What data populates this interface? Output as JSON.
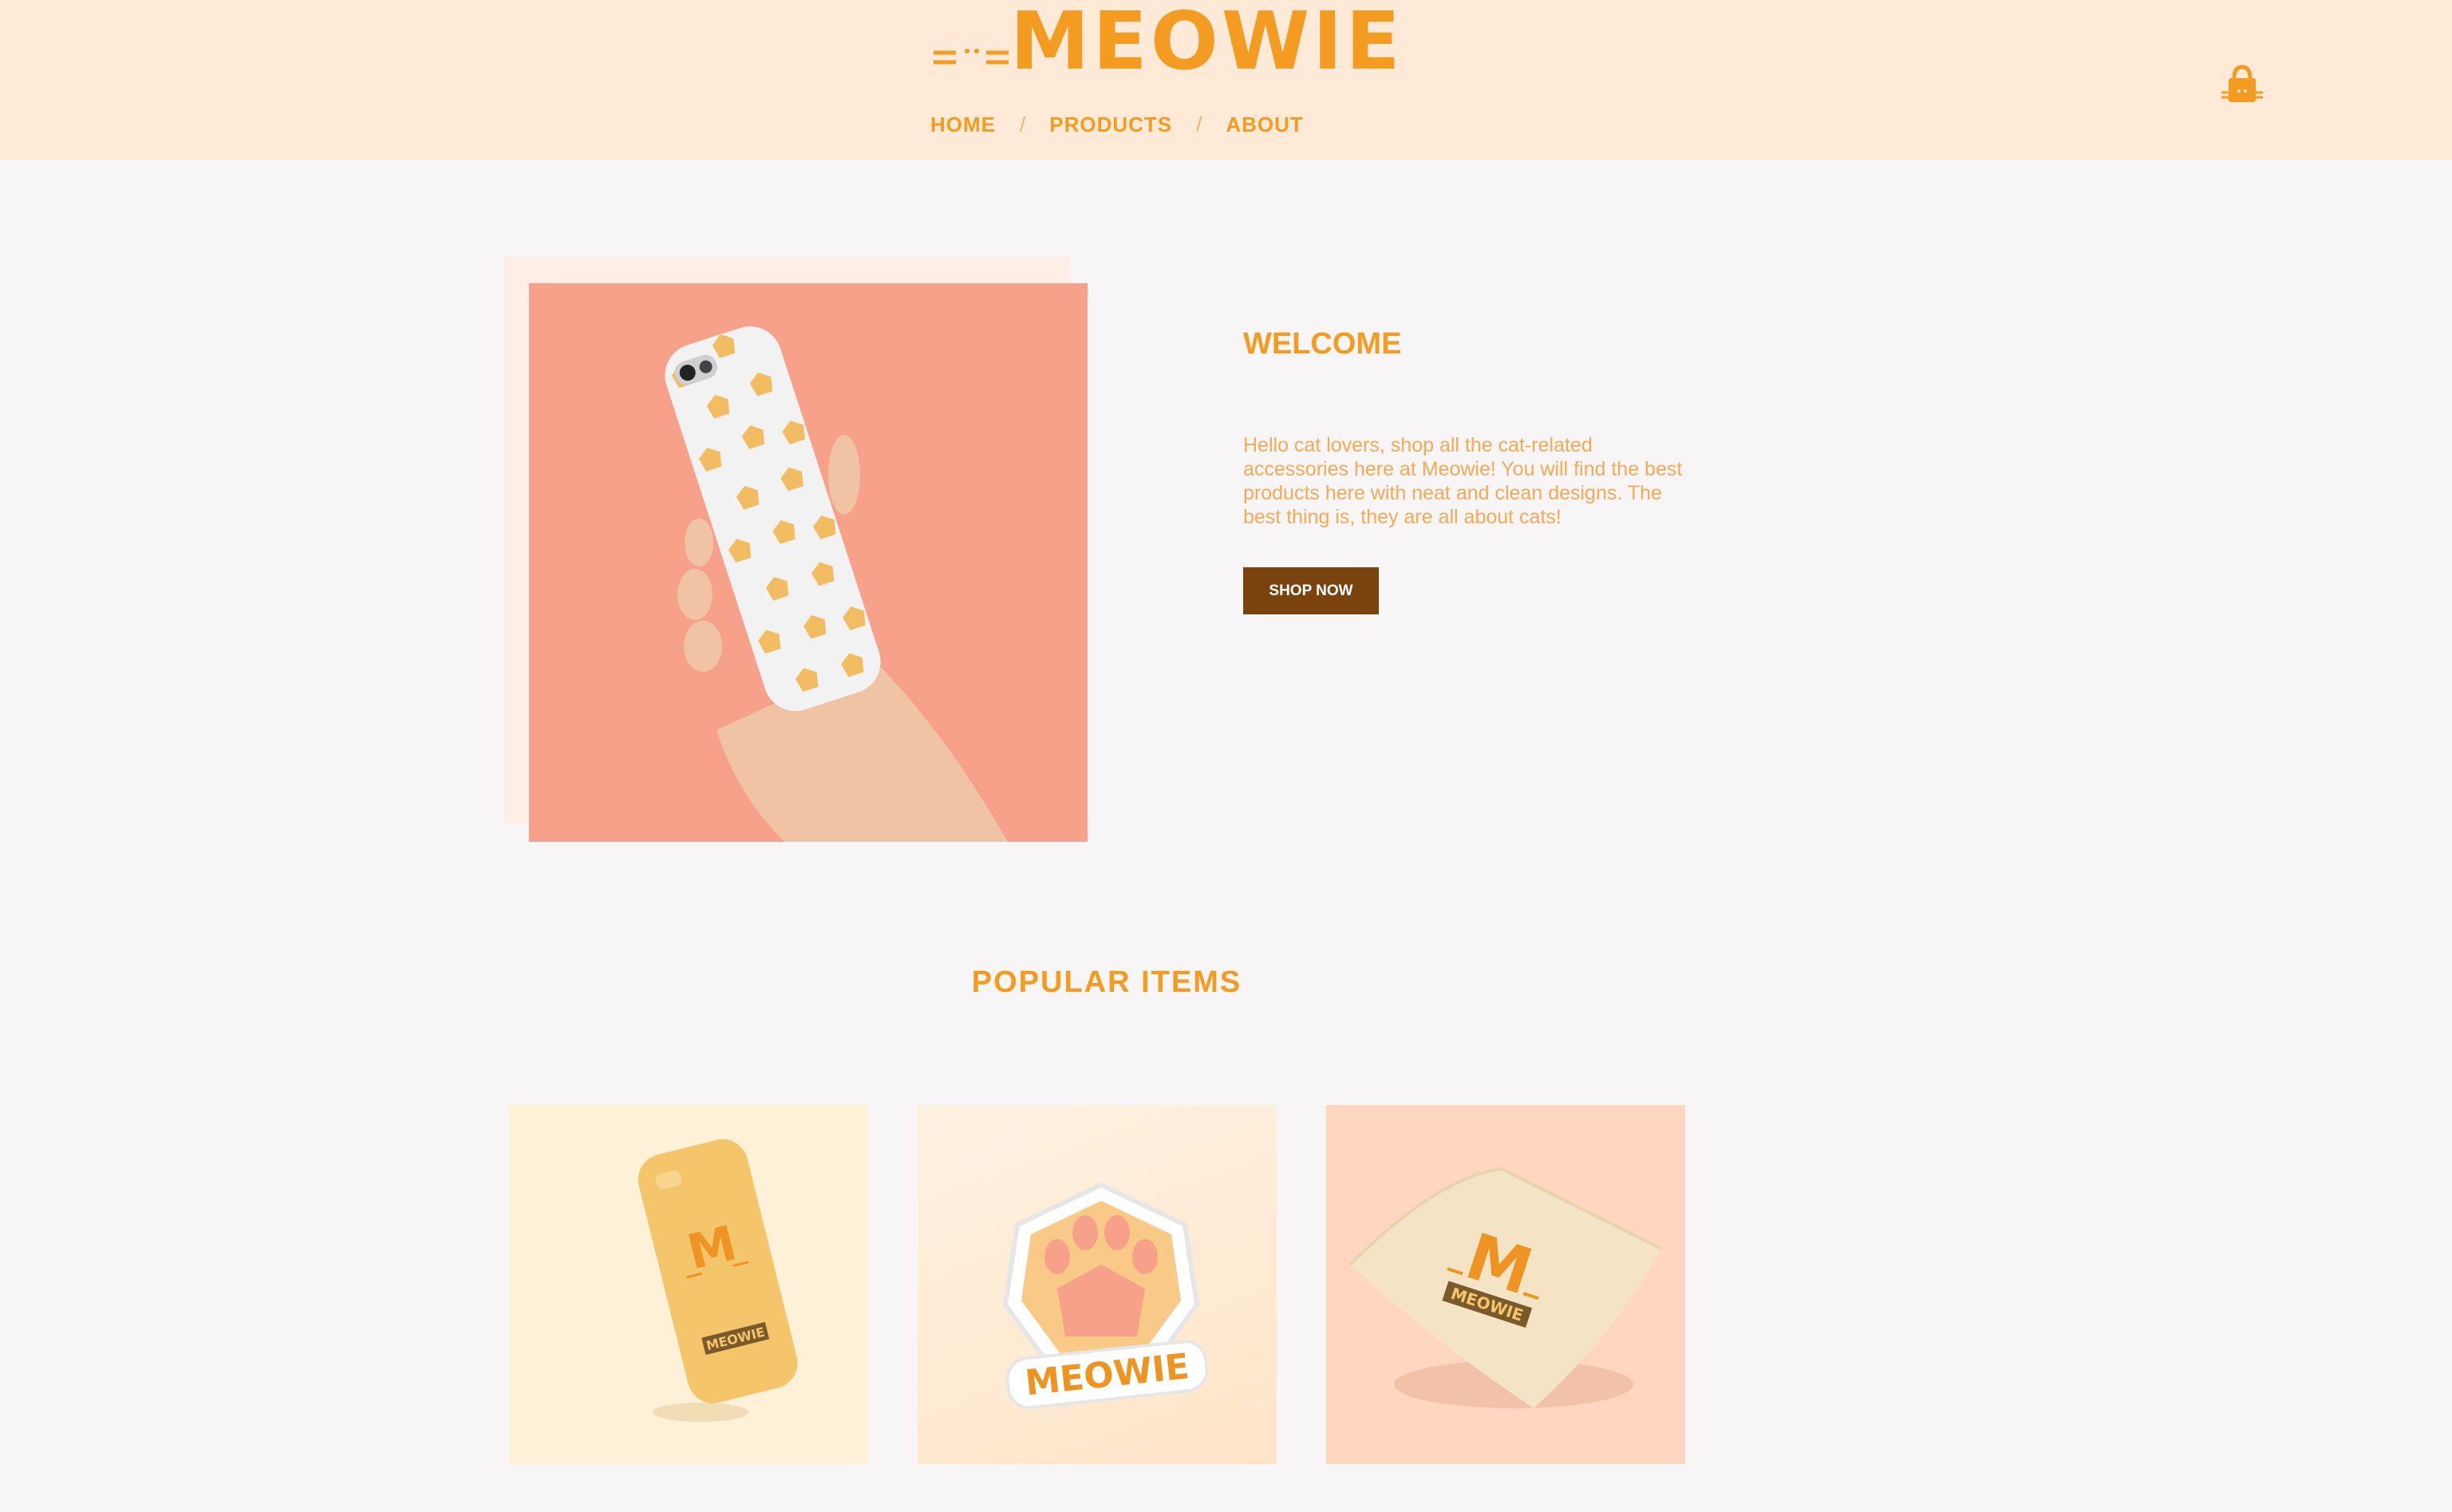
{
  "header": {
    "brand": "MEOWIE",
    "nav": [
      {
        "label": "HOME"
      },
      {
        "label": "PRODUCTS"
      },
      {
        "label": "ABOUT"
      }
    ],
    "separator": "/",
    "cart_icon": "shopping-bag-icon"
  },
  "hero": {
    "title": "WELCOME",
    "text": "Hello cat lovers, shop all the cat-related accessories here at Meowie! You will find the best products here with neat and clean designs. The best thing is, they are all about cats!",
    "button_label": "SHOP NOW",
    "image": "hand-holding-cat-pattern-phone-case"
  },
  "popular": {
    "title": "POPULAR ITEMS",
    "items": [
      {
        "image": "meowie-phone-case",
        "badge_text": "MEOWIE"
      },
      {
        "image": "paw-sticker",
        "badge_text": "MEOWIE"
      },
      {
        "image": "meowie-pillow",
        "badge_text": "MEOWIE"
      }
    ]
  },
  "colors": {
    "accent": "#f39c21",
    "header_bg": "#ffe9d7",
    "button_bg": "#7a420d",
    "page_bg": "#f7f5f5",
    "hero_bg": "#f7a18b"
  }
}
